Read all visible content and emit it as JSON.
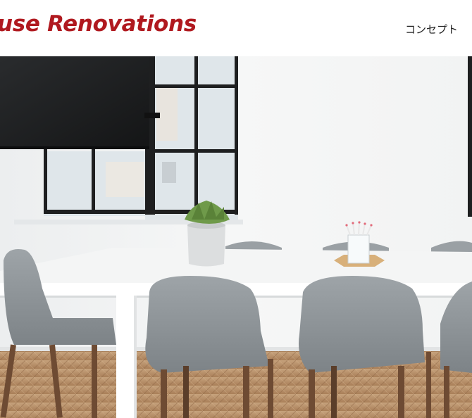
{
  "header": {
    "logo_text": "use Renovations",
    "nav": [
      {
        "label": "コンセプト"
      }
    ]
  },
  "hero": {
    "alt": "Bright office meeting room with a white table, grey chairs and a potted succulent"
  },
  "colors": {
    "brand": "#b0191f",
    "nav_text": "#222222",
    "background": "#ffffff"
  }
}
